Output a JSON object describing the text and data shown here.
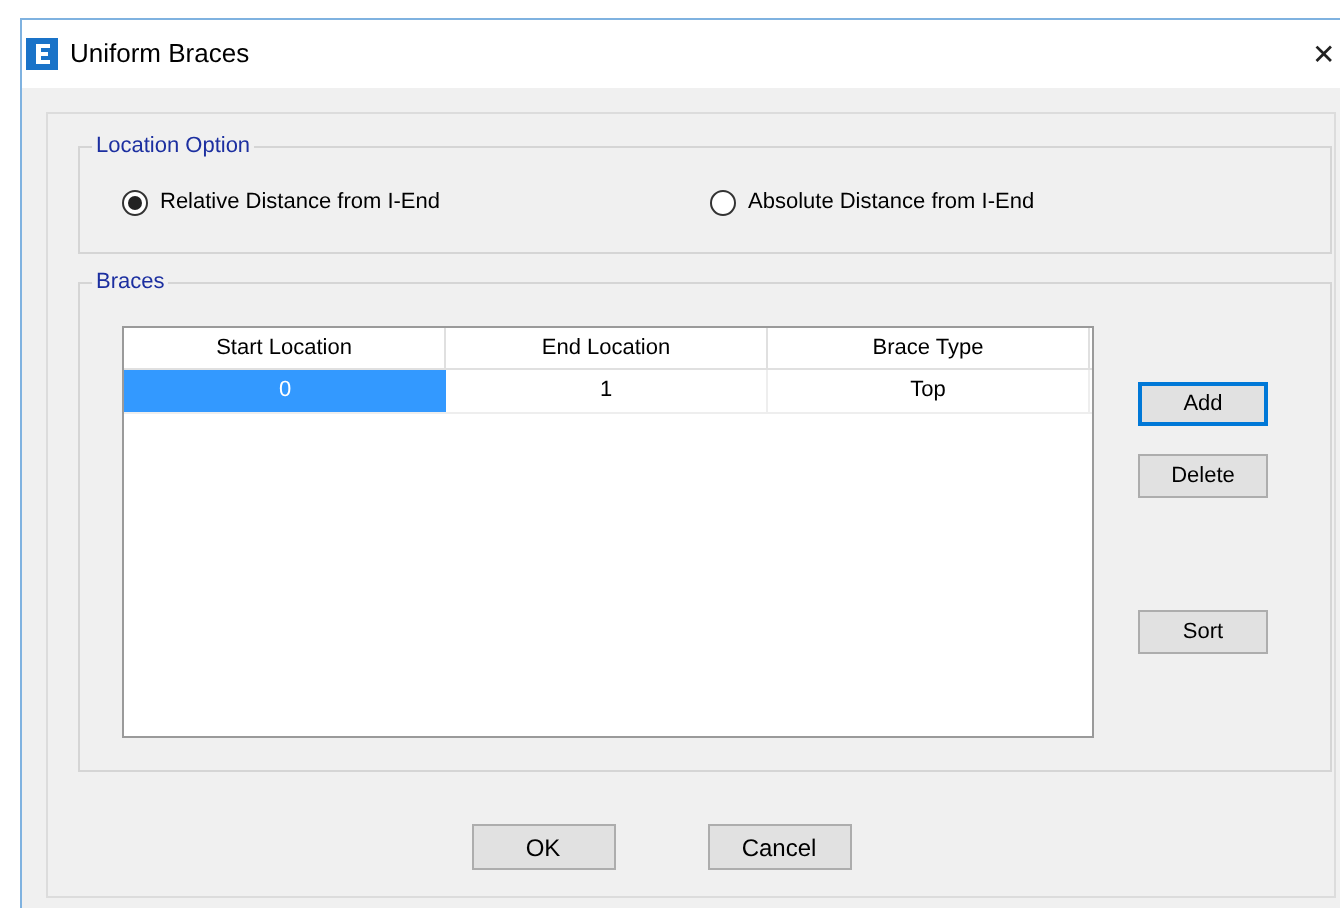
{
  "window": {
    "title": "Uniform Braces",
    "close": "✕"
  },
  "location_option": {
    "title": "Location Option",
    "options": [
      {
        "label": "Relative Distance from I-End",
        "selected": true
      },
      {
        "label": "Absolute Distance from I-End",
        "selected": false
      }
    ]
  },
  "braces": {
    "title": "Braces",
    "table": {
      "columns": [
        "Start Location",
        "End Location",
        "Brace Type"
      ],
      "rows": [
        {
          "cells": [
            {
              "text": "0",
              "selected": true
            },
            {
              "text": "1",
              "selected": false
            },
            {
              "text": "Top",
              "selected": false
            }
          ]
        }
      ]
    },
    "buttons": [
      {
        "label": "Add",
        "focused": true
      },
      {
        "label": "Delete",
        "focused": false
      },
      {
        "label": "Sort",
        "focused": false
      }
    ]
  },
  "footer_buttons": [
    "OK",
    "Cancel"
  ]
}
